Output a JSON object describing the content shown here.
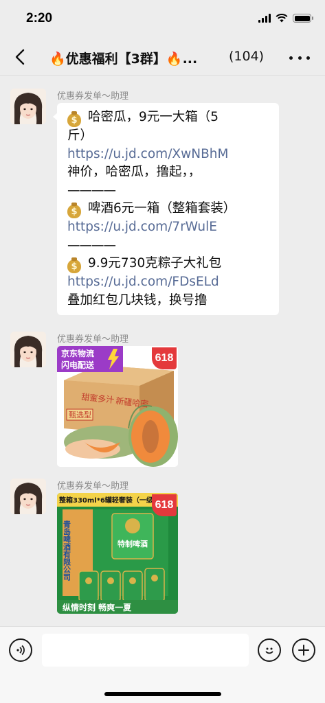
{
  "status_bar": {
    "time": "2:20"
  },
  "nav": {
    "title": "🔥优惠福利【3群】🔥...",
    "title_parts": {
      "fire": "🔥",
      "name": "优惠福利【3群】",
      "ellipsis": "..."
    },
    "member_count": "(104)"
  },
  "messages": [
    {
      "sender": "优惠券发单～助理",
      "type": "text",
      "lines": [
        {
          "kind": "money",
          "text": "哈密瓜，9元一大箱（5"
        },
        {
          "kind": "text",
          "text": "斤）"
        },
        {
          "kind": "link",
          "text": "https://u.jd.com/XwNBhM"
        },
        {
          "kind": "text",
          "text": "神价，哈密瓜，撸起，，"
        },
        {
          "kind": "dash",
          "text": "————"
        },
        {
          "kind": "money",
          "text": "啤酒6元一箱（整箱套装）"
        },
        {
          "kind": "link",
          "text": " https://u.jd.com/7rWulE"
        },
        {
          "kind": "dash",
          "text": "————"
        },
        {
          "kind": "money",
          "text": "9.9元730克粽子大礼包"
        },
        {
          "kind": "link",
          "text": " https://u.jd.com/FDsELd"
        },
        {
          "kind": "text",
          "text": "叠加红包几块钱，换号撸"
        }
      ]
    },
    {
      "sender": "优惠券发单～助理",
      "type": "image",
      "image": {
        "banner": "京东物流\n闪电配送",
        "banner_line1": "京东物流",
        "banner_line2": "闪电配送",
        "badge": "618",
        "box_text_1": "甜蜜多汁",
        "box_text_2": "新疆哈密",
        "box_label": "甄选型"
      }
    },
    {
      "sender": "优惠券发单～助理",
      "type": "image",
      "image": {
        "top_text": "整箱330ml*6罐轻奢装（一级）",
        "badge": "618",
        "box_side_text": "青岛啤酒有限公司",
        "can_label": "特制啤酒",
        "bottom_text": "纵情时刻  畅爽一夏"
      }
    }
  ],
  "input": {
    "placeholder": "",
    "value": ""
  },
  "colors": {
    "link": "#576b95",
    "badge": "#e4393c",
    "banner": "#9b3bc7",
    "bg": "#ededed"
  }
}
